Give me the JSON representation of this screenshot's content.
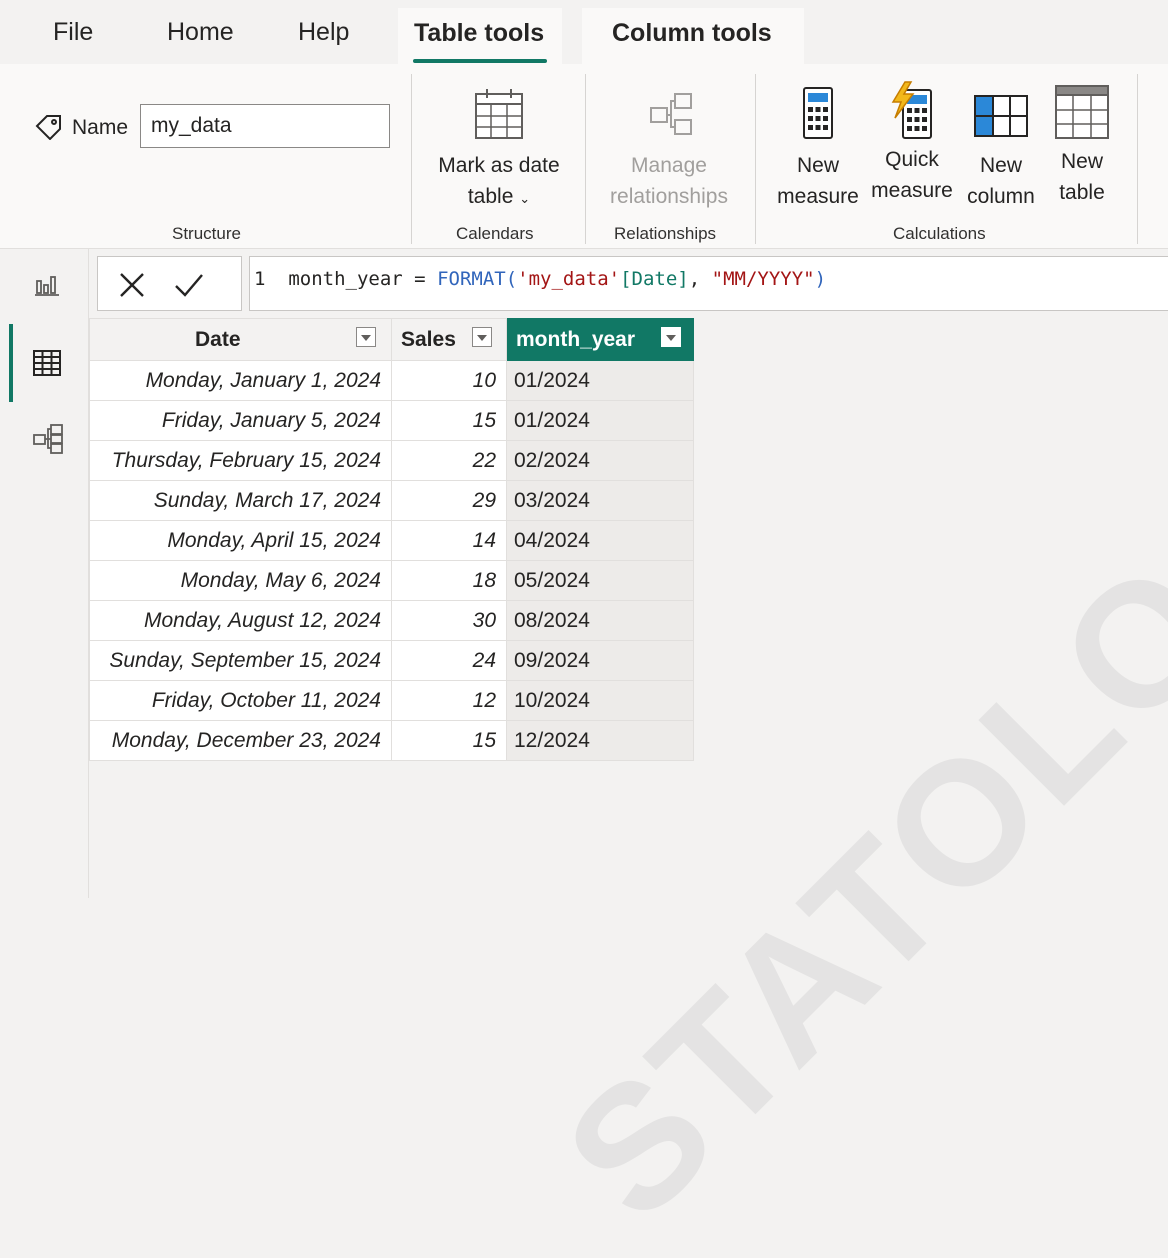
{
  "tabs": [
    {
      "label": "File"
    },
    {
      "label": "Home"
    },
    {
      "label": "Help"
    },
    {
      "label": "Table tools",
      "active": true
    },
    {
      "label": "Column tools"
    }
  ],
  "structure": {
    "name_label": "Name",
    "name_value": "my_data",
    "group_label": "Structure"
  },
  "calendars": {
    "mark_date_line1": "Mark as date",
    "mark_date_line2": "table",
    "group_label": "Calendars"
  },
  "relationships": {
    "manage_line1": "Manage",
    "manage_line2": "relationships",
    "group_label": "Relationships",
    "disabled": true
  },
  "calculations": {
    "new_measure_line1": "New",
    "new_measure_line2": "measure",
    "quick_measure_line1": "Quick",
    "quick_measure_line2": "measure",
    "new_column_line1": "New",
    "new_column_line2": "column",
    "new_table_line1": "New",
    "new_table_line2": "table",
    "group_label": "Calculations"
  },
  "formula": {
    "line_number": "1",
    "column_name": "month_year",
    "operator": " = ",
    "function": "FORMAT(",
    "table_ref": "'my_data'",
    "column_ref": "[Date]",
    "separator": ", ",
    "format_string": "\"MM/YYYY\"",
    "close": ")"
  },
  "table": {
    "columns": [
      "Date",
      "Sales",
      "month_year"
    ],
    "selected_column": "month_year",
    "rows": [
      {
        "date": "Monday, January 1, 2024",
        "sales": "10",
        "month_year": "01/2024"
      },
      {
        "date": "Friday, January 5, 2024",
        "sales": "15",
        "month_year": "01/2024"
      },
      {
        "date": "Thursday, February 15, 2024",
        "sales": "22",
        "month_year": "02/2024"
      },
      {
        "date": "Sunday, March 17, 2024",
        "sales": "29",
        "month_year": "03/2024"
      },
      {
        "date": "Monday, April 15, 2024",
        "sales": "14",
        "month_year": "04/2024"
      },
      {
        "date": "Monday, May 6, 2024",
        "sales": "18",
        "month_year": "05/2024"
      },
      {
        "date": "Monday, August 12, 2024",
        "sales": "30",
        "month_year": "08/2024"
      },
      {
        "date": "Sunday, September 15, 2024",
        "sales": "24",
        "month_year": "09/2024"
      },
      {
        "date": "Friday, October 11, 2024",
        "sales": "12",
        "month_year": "10/2024"
      },
      {
        "date": "Monday, December 23, 2024",
        "sales": "15",
        "month_year": "12/2024"
      }
    ]
  },
  "watermark": "STATOLOGY.COM",
  "colors": {
    "accent": "#117865",
    "function_blue": "#3165bb",
    "string_red": "#a31515"
  },
  "icons": {
    "tag": "tag-icon",
    "calendar": "calendar-table-icon",
    "relationships": "manage-relationships-icon",
    "new_measure": "calculator-icon",
    "quick_measure": "quick-measure-icon",
    "new_column": "new-column-icon",
    "new_table": "new-table-icon",
    "report_view": "report-view-icon",
    "table_view": "table-view-icon",
    "model_view": "model-view-icon",
    "cancel": "cancel-x-icon",
    "commit": "commit-check-icon"
  }
}
